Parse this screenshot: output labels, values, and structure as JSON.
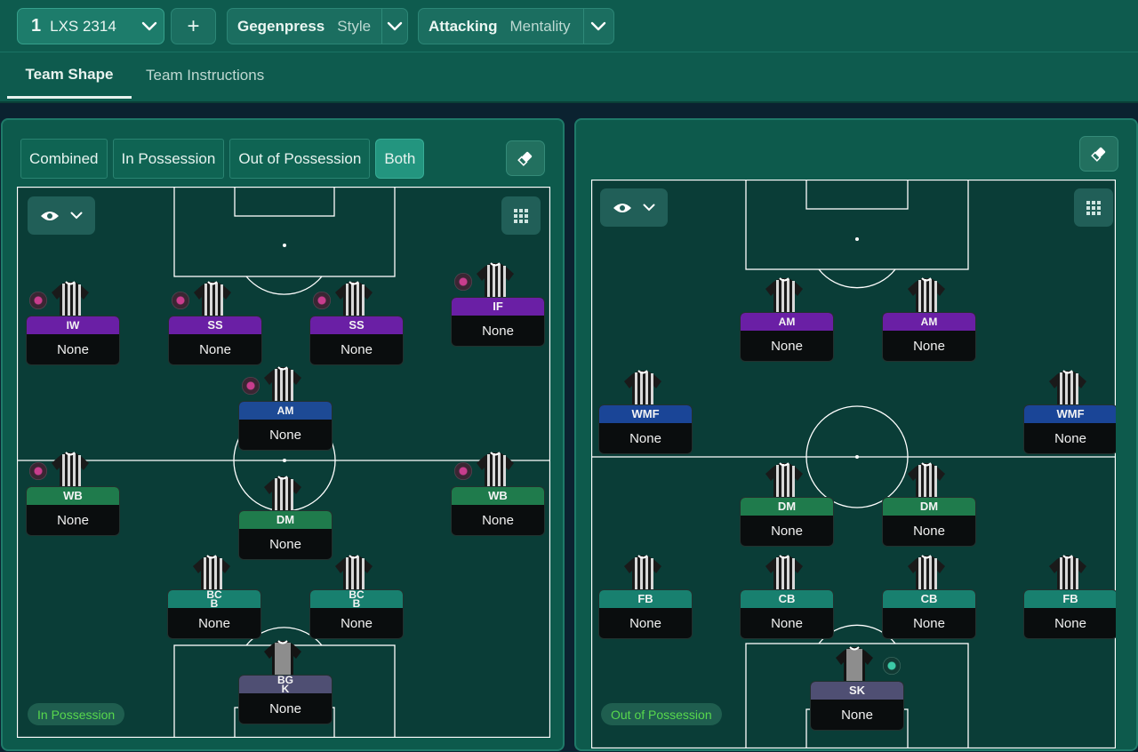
{
  "header": {
    "tactic_number": "1",
    "tactic_name": "LXS 2314",
    "add_label": "+",
    "style_key": "Gegenpress",
    "style_value": "Style",
    "mentality_key": "Attacking",
    "mentality_value": "Mentality"
  },
  "tabs": [
    {
      "label": "Team Shape"
    },
    {
      "label": "Team Instructions"
    }
  ],
  "left_panel": {
    "segments": [
      {
        "label": "Combined"
      },
      {
        "label": "In Possession"
      },
      {
        "label": "Out of Possession"
      },
      {
        "label": "Both"
      }
    ],
    "pill": "In Possession",
    "players": [
      {
        "role": "IW",
        "duty": "None"
      },
      {
        "role": "SS",
        "duty": "None"
      },
      {
        "role": "SS",
        "duty": "None"
      },
      {
        "role": "IF",
        "duty": "None"
      },
      {
        "role": "AM",
        "duty": "None"
      },
      {
        "role": "WB",
        "duty": "None"
      },
      {
        "role": "DM",
        "duty": "None"
      },
      {
        "role": "WB",
        "duty": "None"
      },
      {
        "role": "BCB",
        "duty": "None"
      },
      {
        "role": "BCB",
        "duty": "None"
      },
      {
        "role": "BGK",
        "duty": "None"
      }
    ]
  },
  "right_panel": {
    "pill": "Out of Possession",
    "players": [
      {
        "role": "AM",
        "duty": "None"
      },
      {
        "role": "AM",
        "duty": "None"
      },
      {
        "role": "WMF",
        "duty": "None"
      },
      {
        "role": "WMF",
        "duty": "None"
      },
      {
        "role": "DM",
        "duty": "None"
      },
      {
        "role": "DM",
        "duty": "None"
      },
      {
        "role": "FB",
        "duty": "None"
      },
      {
        "role": "CB",
        "duty": "None"
      },
      {
        "role": "CB",
        "duty": "None"
      },
      {
        "role": "FB",
        "duty": "None"
      },
      {
        "role": "SK",
        "duty": "None"
      }
    ]
  },
  "colors": {
    "attack": "#6a1fa5",
    "support": "#1a4597",
    "midfield": "#1f7b4c",
    "defence": "#18806f",
    "keeper": "#4f4f73",
    "pill_text": "#58d84d"
  },
  "icons": [
    "chevron-down-icon",
    "plus-icon",
    "eraser-icon",
    "eye-icon",
    "grid-icon",
    "shirt-icon",
    "role-familiarity-icon"
  ]
}
